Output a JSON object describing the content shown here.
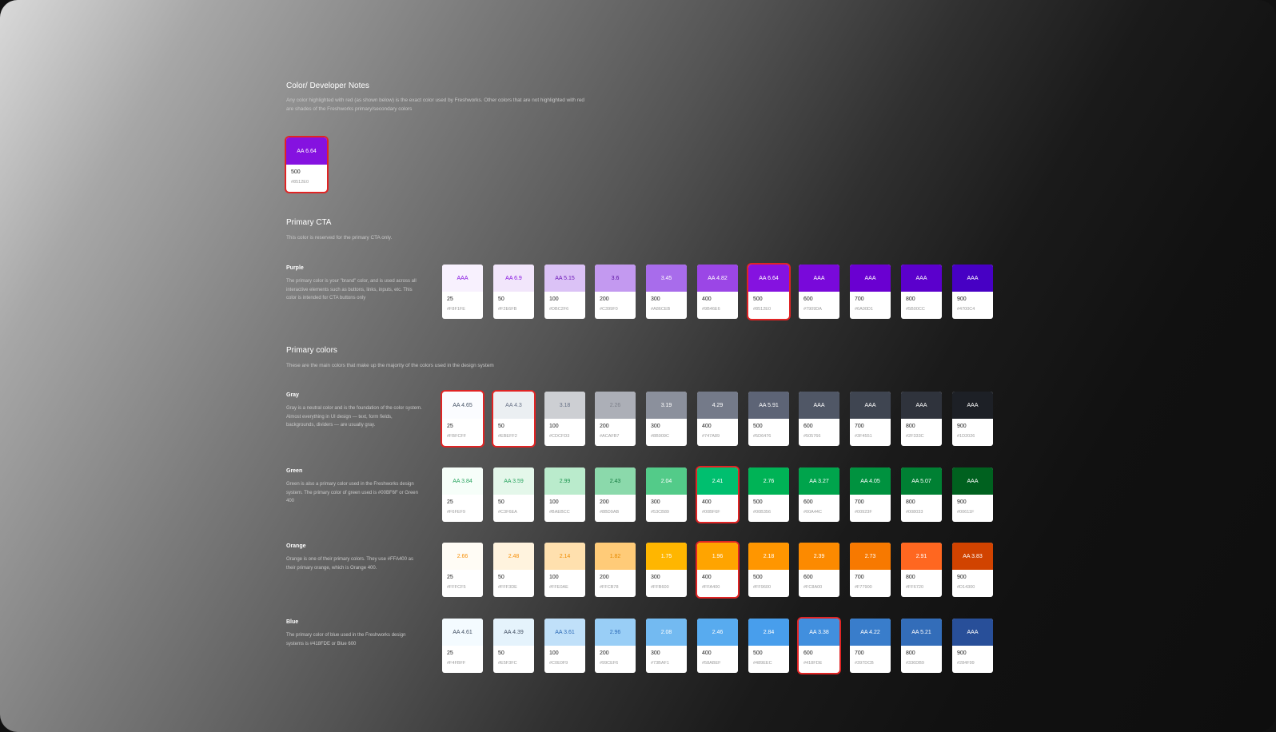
{
  "notes": {
    "title": "Color/ Developer Notes",
    "desc": "Any color highlighted with red (as shown below) is the exact color used by Freshworks. Other colors that are not highlighted with red are shades of the Freshworks primary/secondary colors",
    "sample": {
      "rating": "AA 6.64",
      "shade": "500",
      "hex": "#8512E0",
      "bg": "#8512E0",
      "fg": "#FFFFFF",
      "hl": true
    }
  },
  "primary_cta": {
    "title": "Primary CTA",
    "desc": "This color is reserved for the primary CTA only."
  },
  "primary_colors": {
    "title": "Primary colors",
    "desc": "These are the main colors that make up the majority of the colors used in the design system"
  },
  "palettes": [
    {
      "name": "Purple",
      "desc": "The primary color is your \"brand\" color, and is used across all interactive elements such as buttons, links, inputs, etc. This color is intended for CTA buttons only",
      "swatches": [
        {
          "rating": "AAA",
          "shade": "25",
          "hex": "#F8F1FE",
          "bg": "#F8F1FE",
          "fg": "#8512E0",
          "hl": false
        },
        {
          "rating": "AA 6.9",
          "shade": "50",
          "hex": "#F2E6FB",
          "bg": "#F2E6FB",
          "fg": "#8512E0",
          "hl": false
        },
        {
          "rating": "AA 5.15",
          "shade": "100",
          "hex": "#DBC2F6",
          "bg": "#DBC2F6",
          "fg": "#6C16B8",
          "hl": false
        },
        {
          "rating": "3.6",
          "shade": "200",
          "hex": "#C399F0",
          "bg": "#C399F0",
          "fg": "#5A0FA0",
          "hl": false
        },
        {
          "rating": "3.45",
          "shade": "300",
          "hex": "#A86CEB",
          "bg": "#A86CEB",
          "fg": "#FFFFFF",
          "hl": false
        },
        {
          "rating": "AA 4.82",
          "shade": "400",
          "hex": "#9B46E6",
          "bg": "#9B46E6",
          "fg": "#FFFFFF",
          "hl": false
        },
        {
          "rating": "AA 6.64",
          "shade": "500",
          "hex": "#8512E0",
          "bg": "#8512E0",
          "fg": "#FFFFFF",
          "hl": true
        },
        {
          "rating": "AAA",
          "shade": "600",
          "hex": "#7909DA",
          "bg": "#7909DA",
          "fg": "#FFFFFF",
          "hl": false
        },
        {
          "rating": "AAA",
          "shade": "700",
          "hex": "#6A00D1",
          "bg": "#6A00D1",
          "fg": "#FFFFFF",
          "hl": false
        },
        {
          "rating": "AAA",
          "shade": "800",
          "hex": "#5B00CC",
          "bg": "#5B00CC",
          "fg": "#FFFFFF",
          "hl": false
        },
        {
          "rating": "AAA",
          "shade": "900",
          "hex": "#4700C4",
          "bg": "#4700C4",
          "fg": "#FFFFFF",
          "hl": false
        }
      ]
    },
    {
      "name": "Gray",
      "desc": "Gray is a neutral color and is the foundation of the color system. Almost everything in UI design — text, form fields, backgrounds, dividers — are usually gray.",
      "swatches": [
        {
          "rating": "AA 4.65",
          "shade": "25",
          "hex": "#FBFCFF",
          "bg": "#FBFCFF",
          "fg": "#475467",
          "hl": true
        },
        {
          "rating": "AA 4.3",
          "shade": "50",
          "hex": "#EBEFF2",
          "bg": "#EBEFF2",
          "fg": "#667085",
          "hl": true
        },
        {
          "rating": "3.18",
          "shade": "100",
          "hex": "#CDCFD3",
          "bg": "#CDCFD3",
          "fg": "#667085",
          "hl": false
        },
        {
          "rating": "2.26",
          "shade": "200",
          "hex": "#ACAFB7",
          "bg": "#ACAFB7",
          "fg": "#7D808A",
          "hl": false
        },
        {
          "rating": "3.19",
          "shade": "300",
          "hex": "#8B909C",
          "bg": "#8B909C",
          "fg": "#FFFFFF",
          "hl": false
        },
        {
          "rating": "4.29",
          "shade": "400",
          "hex": "#747A89",
          "bg": "#747A89",
          "fg": "#FFFFFF",
          "hl": false
        },
        {
          "rating": "AA 5.91",
          "shade": "500",
          "hex": "#5D6476",
          "bg": "#5D6476",
          "fg": "#FFFFFF",
          "hl": false
        },
        {
          "rating": "AAA",
          "shade": "600",
          "hex": "#505766",
          "bg": "#505766",
          "fg": "#FFFFFF",
          "hl": false
        },
        {
          "rating": "AAA",
          "shade": "700",
          "hex": "#3F4551",
          "bg": "#3F4551",
          "fg": "#FFFFFF",
          "hl": false
        },
        {
          "rating": "AAA",
          "shade": "800",
          "hex": "#2F333C",
          "bg": "#2F333C",
          "fg": "#FFFFFF",
          "hl": false
        },
        {
          "rating": "AAA",
          "shade": "900",
          "hex": "#1D2026",
          "bg": "#1D2026",
          "fg": "#FFFFFF",
          "hl": false
        }
      ]
    },
    {
      "name": "Green",
      "desc": "Green is also a primary color used in the Freshworks design system. The primary color of green used is #00BF6F or Green 400",
      "swatches": [
        {
          "rating": "AA 3.84",
          "shade": "25",
          "hex": "#F6FEF9",
          "bg": "#F6FEF9",
          "fg": "#2BA561",
          "hl": false
        },
        {
          "rating": "AA 3.59",
          "shade": "50",
          "hex": "#C3F6EA",
          "bg": "#E4F7EA",
          "fg": "#2BA561",
          "hl": false
        },
        {
          "rating": "2.99",
          "shade": "100",
          "hex": "#BAEBCC",
          "bg": "#BAEBCC",
          "fg": "#1E9550",
          "hl": false
        },
        {
          "rating": "2.43",
          "shade": "200",
          "hex": "#8BD9AB",
          "bg": "#8BD9AB",
          "fg": "#137A3F",
          "hl": false
        },
        {
          "rating": "2.04",
          "shade": "300",
          "hex": "#53CB89",
          "bg": "#53CB89",
          "fg": "#FFFFFF",
          "hl": false
        },
        {
          "rating": "2.41",
          "shade": "400",
          "hex": "#00BF6F",
          "bg": "#00BF6F",
          "fg": "#FFFFFF",
          "hl": true
        },
        {
          "rating": "2.76",
          "shade": "500",
          "hex": "#00B356",
          "bg": "#00B356",
          "fg": "#FFFFFF",
          "hl": false
        },
        {
          "rating": "AA 3.27",
          "shade": "600",
          "hex": "#00A44C",
          "bg": "#00A44C",
          "fg": "#FFFFFF",
          "hl": false
        },
        {
          "rating": "AA 4.05",
          "shade": "700",
          "hex": "#00923F",
          "bg": "#00923F",
          "fg": "#FFFFFF",
          "hl": false
        },
        {
          "rating": "AA 5.07",
          "shade": "800",
          "hex": "#008033",
          "bg": "#008033",
          "fg": "#FFFFFF",
          "hl": false
        },
        {
          "rating": "AAA",
          "shade": "900",
          "hex": "#00611F",
          "bg": "#00611F",
          "fg": "#FFFFFF",
          "hl": false
        }
      ]
    },
    {
      "name": "Orange",
      "desc": "Orange is one of their primary colors. They use #FFA400 as their primary orange, which is Orange 400.",
      "swatches": [
        {
          "rating": "2.66",
          "shade": "25",
          "hex": "#FFFCF5",
          "bg": "#FFFCF5",
          "fg": "#F79009",
          "hl": false
        },
        {
          "rating": "2.48",
          "shade": "50",
          "hex": "#FFF3DE",
          "bg": "#FFF3DE",
          "fg": "#F79009",
          "hl": false
        },
        {
          "rating": "2.14",
          "shade": "100",
          "hex": "#FFE0AE",
          "bg": "#FFE0AE",
          "fg": "#F08C00",
          "hl": false
        },
        {
          "rating": "1.82",
          "shade": "200",
          "hex": "#FFCB78",
          "bg": "#FFCB78",
          "fg": "#E58A00",
          "hl": false
        },
        {
          "rating": "1.75",
          "shade": "300",
          "hex": "#FFB600",
          "bg": "#FFB600",
          "fg": "#FFFFFF",
          "hl": false
        },
        {
          "rating": "1.96",
          "shade": "400",
          "hex": "#FFA400",
          "bg": "#FFA400",
          "fg": "#FFFFFF",
          "hl": true
        },
        {
          "rating": "2.18",
          "shade": "500",
          "hex": "#FF9600",
          "bg": "#FF9600",
          "fg": "#FFFFFF",
          "hl": false
        },
        {
          "rating": "2.39",
          "shade": "600",
          "hex": "#FC8A00",
          "bg": "#FC8A00",
          "fg": "#FFFFFF",
          "hl": false
        },
        {
          "rating": "2.73",
          "shade": "700",
          "hex": "#F77900",
          "bg": "#F77900",
          "fg": "#FFFFFF",
          "hl": false
        },
        {
          "rating": "2.91",
          "shade": "800",
          "hex": "#FF6720",
          "bg": "#FF6720",
          "fg": "#FFFFFF",
          "hl": false
        },
        {
          "rating": "AA 3.83",
          "shade": "900",
          "hex": "#D14300",
          "bg": "#D14300",
          "fg": "#FFFFFF",
          "hl": false
        }
      ]
    },
    {
      "name": "Blue",
      "desc": "The primary color of blue used in the Freshworks design systems is #418FDE or Blue 600",
      "swatches": [
        {
          "rating": "AA 4.61",
          "shade": "25",
          "hex": "#F4FBFF",
          "bg": "#F4FBFF",
          "fg": "#475467",
          "hl": false
        },
        {
          "rating": "AA 4.39",
          "shade": "50",
          "hex": "#E5F3FC",
          "bg": "#E5F3FC",
          "fg": "#475467",
          "hl": false
        },
        {
          "rating": "AA 3.61",
          "shade": "100",
          "hex": "#C0E0F9",
          "bg": "#C0E0F9",
          "fg": "#2E6CB8",
          "hl": false
        },
        {
          "rating": "2.96",
          "shade": "200",
          "hex": "#99CEF6",
          "bg": "#99CEF6",
          "fg": "#2E6CB8",
          "hl": false
        },
        {
          "rating": "2.08",
          "shade": "300",
          "hex": "#73BAF1",
          "bg": "#73BAF1",
          "fg": "#FFFFFF",
          "hl": false
        },
        {
          "rating": "2.46",
          "shade": "400",
          "hex": "#58ABEF",
          "bg": "#58ABEF",
          "fg": "#FFFFFF",
          "hl": false
        },
        {
          "rating": "2.84",
          "shade": "500",
          "hex": "#489EEC",
          "bg": "#489EEC",
          "fg": "#FFFFFF",
          "hl": false
        },
        {
          "rating": "AA 3.38",
          "shade": "600",
          "hex": "#418FDE",
          "bg": "#418FDE",
          "fg": "#FFFFFF",
          "hl": true
        },
        {
          "rating": "AA 4.22",
          "shade": "700",
          "hex": "#397DCB",
          "bg": "#397DCB",
          "fg": "#FFFFFF",
          "hl": false
        },
        {
          "rating": "AA 5.21",
          "shade": "800",
          "hex": "#336DB9",
          "bg": "#336DB9",
          "fg": "#FFFFFF",
          "hl": false
        },
        {
          "rating": "AAA",
          "shade": "900",
          "hex": "#284F99",
          "bg": "#284F99",
          "fg": "#FFFFFF",
          "hl": false
        }
      ]
    }
  ]
}
